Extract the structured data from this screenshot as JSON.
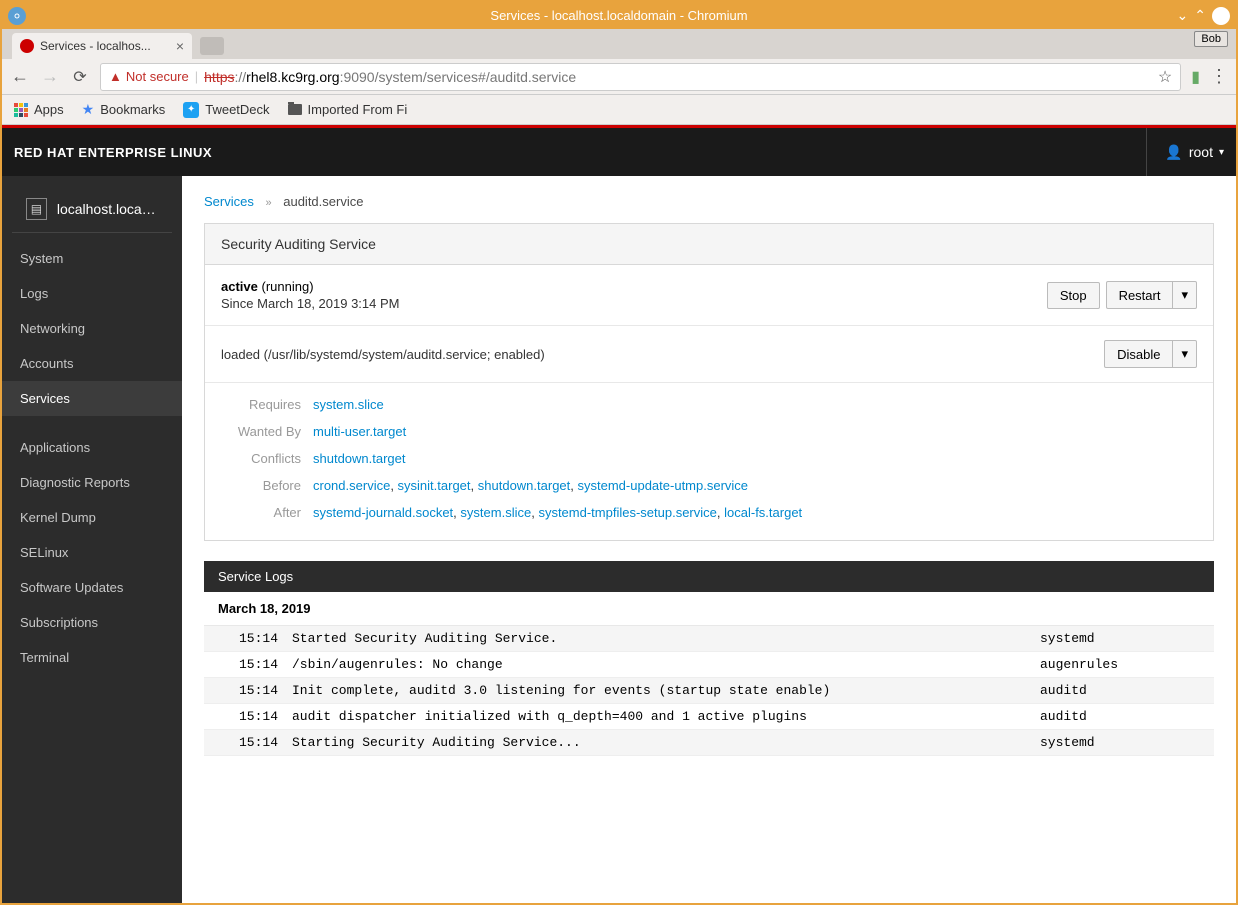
{
  "window": {
    "title": "Services - localhost.localdomain - Chromium",
    "bob": "Bob"
  },
  "browser": {
    "tab_title": "Services - localhos...",
    "not_secure": "Not secure",
    "url_proto": "https",
    "url_host": "rhel8.kc9rg.org",
    "url_port_path": ":9090/system/services#/auditd.service",
    "bookmarks": {
      "apps": "Apps",
      "bookmarks": "Bookmarks",
      "tweetdeck": "TweetDeck",
      "imported": "Imported From Fi"
    }
  },
  "header": {
    "brand": "RED HAT ENTERPRISE LINUX",
    "user": "root"
  },
  "sidebar": {
    "host": "localhost.locald...",
    "items1": [
      "System",
      "Logs",
      "Networking",
      "Accounts",
      "Services"
    ],
    "items2": [
      "Applications",
      "Diagnostic Reports",
      "Kernel Dump",
      "SELinux",
      "Software Updates",
      "Subscriptions",
      "Terminal"
    ],
    "active": "Services"
  },
  "breadcrumb": {
    "root": "Services",
    "current": "auditd.service"
  },
  "service": {
    "title": "Security Auditing Service",
    "state_label": "active",
    "state_sub": "(running)",
    "since": "Since March 18, 2019 3:14 PM",
    "loaded": "loaded (/usr/lib/systemd/system/auditd.service; enabled)",
    "btn_stop": "Stop",
    "btn_restart": "Restart",
    "btn_disable": "Disable",
    "deps": {
      "Requires": [
        {
          "t": "system.slice"
        }
      ],
      "Wanted By": [
        {
          "t": "multi-user.target"
        }
      ],
      "Conflicts": [
        {
          "t": "shutdown.target"
        }
      ],
      "Before": [
        {
          "t": "crond.service"
        },
        {
          "t": "sysinit.target"
        },
        {
          "t": "shutdown.target"
        },
        {
          "t": "systemd-update-utmp.service"
        }
      ],
      "After": [
        {
          "t": "systemd-journald.socket"
        },
        {
          "t": "system.slice"
        },
        {
          "t": "systemd-tmpfiles-setup.service"
        },
        {
          "t": "local-fs.target"
        }
      ]
    }
  },
  "logs": {
    "title": "Service Logs",
    "date": "March 18, 2019",
    "entries": [
      {
        "time": "15:14",
        "msg": "Started Security Auditing Service.",
        "src": "systemd"
      },
      {
        "time": "15:14",
        "msg": "/sbin/augenrules: No change",
        "src": "augenrules"
      },
      {
        "time": "15:14",
        "msg": "Init complete, auditd 3.0 listening for events (startup state enable)",
        "src": "auditd"
      },
      {
        "time": "15:14",
        "msg": "audit dispatcher initialized with q_depth=400 and 1 active plugins",
        "src": "auditd"
      },
      {
        "time": "15:14",
        "msg": "Starting Security Auditing Service...",
        "src": "systemd"
      }
    ]
  }
}
